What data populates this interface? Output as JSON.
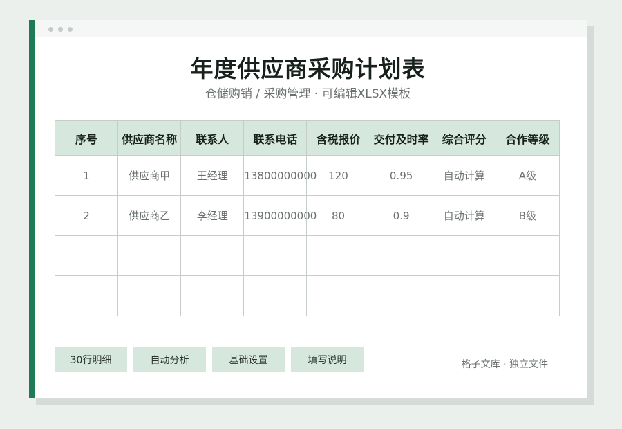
{
  "title": "年度供应商采购计划表",
  "subtitle": "仓储购销 / 采购管理 · 可编辑XLSX模板",
  "table": {
    "headers": [
      "序号",
      "供应商名称",
      "联系人",
      "联系电话",
      "含税报价",
      "交付及时率",
      "综合评分",
      "合作等级"
    ],
    "rows": [
      [
        "1",
        "供应商甲",
        "王经理",
        "13800000000",
        "120",
        "0.95",
        "自动计算",
        "A级"
      ],
      [
        "2",
        "供应商乙",
        "李经理",
        "13900000000",
        "80",
        "0.9",
        "自动计算",
        "B级"
      ],
      [
        "",
        "",
        "",
        "",
        "",
        "",
        "",
        ""
      ],
      [
        "",
        "",
        "",
        "",
        "",
        "",
        "",
        ""
      ]
    ]
  },
  "buttons": [
    "30行明细",
    "自动分析",
    "基础设置",
    "填写说明"
  ],
  "footer": "格子文库 · 独立文件",
  "colors": {
    "accent": "#1f7a57",
    "header_bg": "#d6e8dd",
    "background": "#ecf0ed"
  }
}
